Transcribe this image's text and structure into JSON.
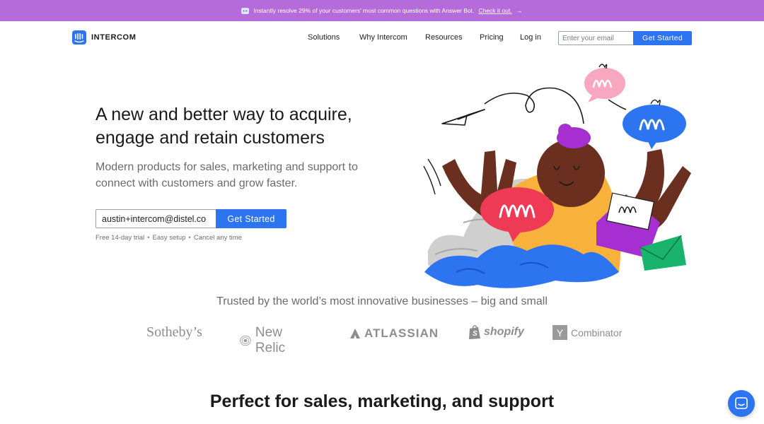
{
  "banner": {
    "text": "Instantly resolve 29% of your customers' most common questions with Answer Bot.",
    "link_label": "Check it out.",
    "arrow": "→",
    "icon": "answer-bot-icon",
    "background": "#b56bd9"
  },
  "header": {
    "brand": "INTERCOM",
    "nav": {
      "solutions": "Solutions",
      "why": "Why Intercom",
      "resources": "Resources",
      "pricing": "Pricing",
      "login": "Log in"
    },
    "email_placeholder": "Enter your email",
    "cta_label": "Get Started"
  },
  "hero": {
    "title": "A new and better way to acquire, engage and retain customers",
    "subtitle": "Modern products for sales, marketing and support to connect with customers and grow faster.",
    "email_value": "austin+intercom@distel.co",
    "cta_label": "Get Started",
    "notes": [
      "Free 14-day trial",
      "Easy setup",
      "Cancel any time"
    ],
    "separator": "•"
  },
  "trusted": {
    "heading": "Trusted by the world’s most innovative businesses – big and small",
    "logos": {
      "sothebys": "Sotheby’s",
      "newrelic": "New Relic",
      "atlassian": "ATLASSIAN",
      "shopify": "shopify",
      "yc_mark": "Y",
      "yc_text": "Combinator"
    }
  },
  "section": {
    "title": "Perfect for sales, marketing, and support"
  },
  "colors": {
    "accent": "#2c74f0",
    "banner": "#b56bd9",
    "text_dark": "#1a1a1a",
    "text_muted": "#6b6b6b"
  }
}
